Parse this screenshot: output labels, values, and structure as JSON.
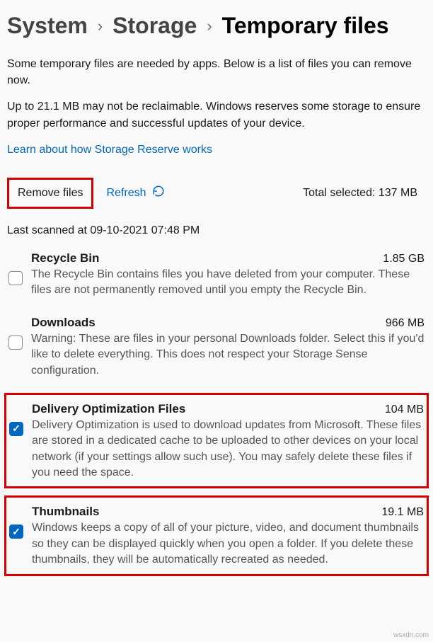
{
  "breadcrumb": {
    "level1": "System",
    "level2": "Storage",
    "current": "Temporary files"
  },
  "intro": {
    "p1": "Some temporary files are needed by apps. Below is a list of files you can remove now.",
    "p2": "Up to 21.1 MB may not be reclaimable. Windows reserves some storage to ensure proper performance and successful updates of your device.",
    "link": "Learn about how Storage Reserve works"
  },
  "actions": {
    "remove": "Remove files",
    "refresh": "Refresh",
    "total_label": "Total selected: 137 MB"
  },
  "last_scanned": "Last scanned at 09-10-2021 07:48 PM",
  "items": [
    {
      "title": "Recycle Bin",
      "size": "1.85 GB",
      "desc": "The Recycle Bin contains files you have deleted from your computer. These files are not permanently removed until you empty the Recycle Bin.",
      "checked": false,
      "highlighted": false
    },
    {
      "title": "Downloads",
      "size": "966 MB",
      "desc": "Warning: These are files in your personal Downloads folder. Select this if you'd like to delete everything. This does not respect your Storage Sense configuration.",
      "checked": false,
      "highlighted": false
    },
    {
      "title": "Delivery Optimization Files",
      "size": "104 MB",
      "desc": "Delivery Optimization is used to download updates from Microsoft. These files are stored in a dedicated cache to be uploaded to other devices on your local network (if your settings allow such use). You may safely delete these files if you need the space.",
      "checked": true,
      "highlighted": true
    },
    {
      "title": "Thumbnails",
      "size": "19.1 MB",
      "desc": "Windows keeps a copy of all of your picture, video, and document thumbnails so they can be displayed quickly when you open a folder. If you delete these thumbnails, they will be automatically recreated as needed.",
      "checked": true,
      "highlighted": true
    }
  ],
  "watermark": "wsxdn.com"
}
